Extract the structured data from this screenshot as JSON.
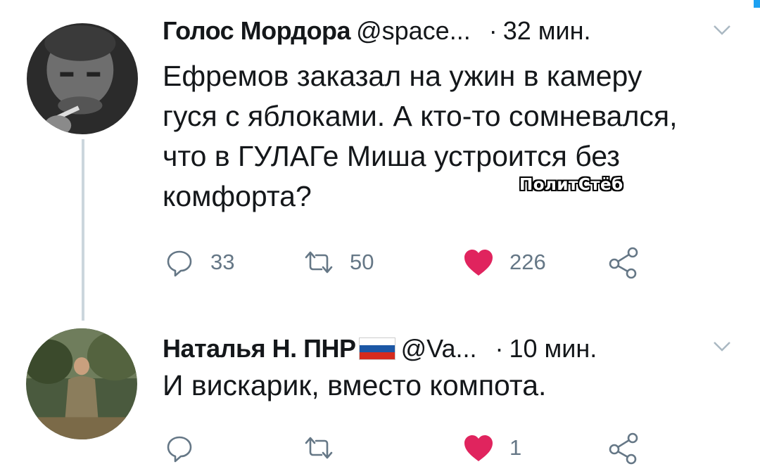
{
  "tweets": [
    {
      "author_name": "Голос Мордора",
      "handle": "@space...",
      "separator": "·",
      "time": "32 мин.",
      "text": "Ефремов заказал на ужин в камеру\nгуся с яблоками. А кто-то сомневался,\nчто в ГУЛАГе Миша устроится без\nкомфорта?",
      "watermark": "ПолитСтёб",
      "replies": "33",
      "retweets": "50",
      "likes": "226",
      "liked": true
    },
    {
      "author_name": "Наталья Н. ПНР",
      "handle": "@Va...",
      "separator": "·",
      "time": "10 мин.",
      "text": "И вискарик, вместо компота.",
      "flag": "russian-flag",
      "replies": "",
      "retweets": "",
      "likes": "1",
      "liked": true
    }
  ],
  "colors": {
    "like_red": "#e0245e",
    "icon_gray": "#657786",
    "thread_line": "#ccd6dd",
    "accent": "#1da1f2"
  },
  "icons": [
    "reply-icon",
    "retweet-icon",
    "like-icon",
    "share-icon",
    "chevron-down-icon"
  ]
}
